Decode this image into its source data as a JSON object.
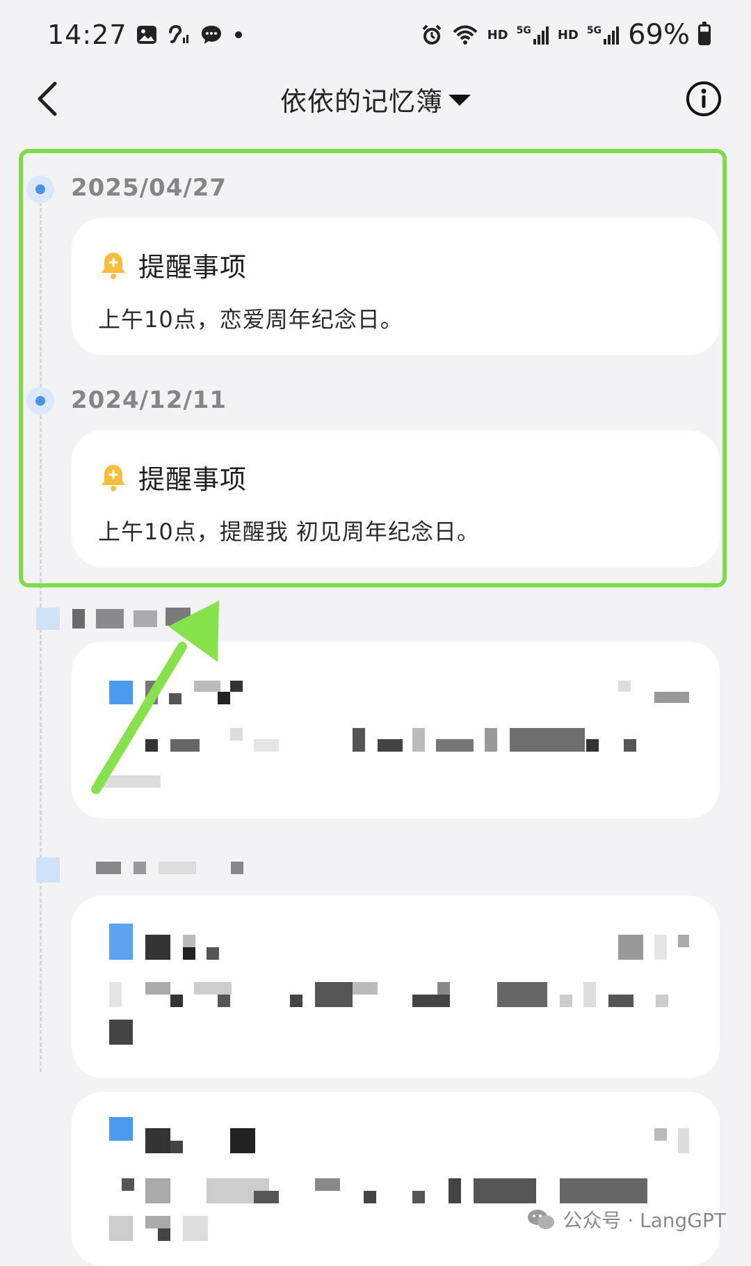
{
  "status_bar": {
    "time": "14:27",
    "hd1": "HD",
    "sig1": "5G",
    "hd2": "HD",
    "sig2": "5G",
    "battery": "69%"
  },
  "header": {
    "title": "依依的记忆簿"
  },
  "timeline": [
    {
      "date": "2025/04/27",
      "card_title": "提醒事项",
      "card_body": "上午10点，恋爱周年纪念日。"
    },
    {
      "date": "2024/12/11",
      "card_title": "提醒事项",
      "card_body": "上午10点，提醒我 初见周年纪念日。"
    }
  ],
  "colors": {
    "highlight": "#7ddc48",
    "arrow": "#86e24b",
    "timeline_dot": "#4a92e8",
    "bell": "#f6be3c"
  },
  "watermark": {
    "text": "公众号 · LangGPT"
  }
}
